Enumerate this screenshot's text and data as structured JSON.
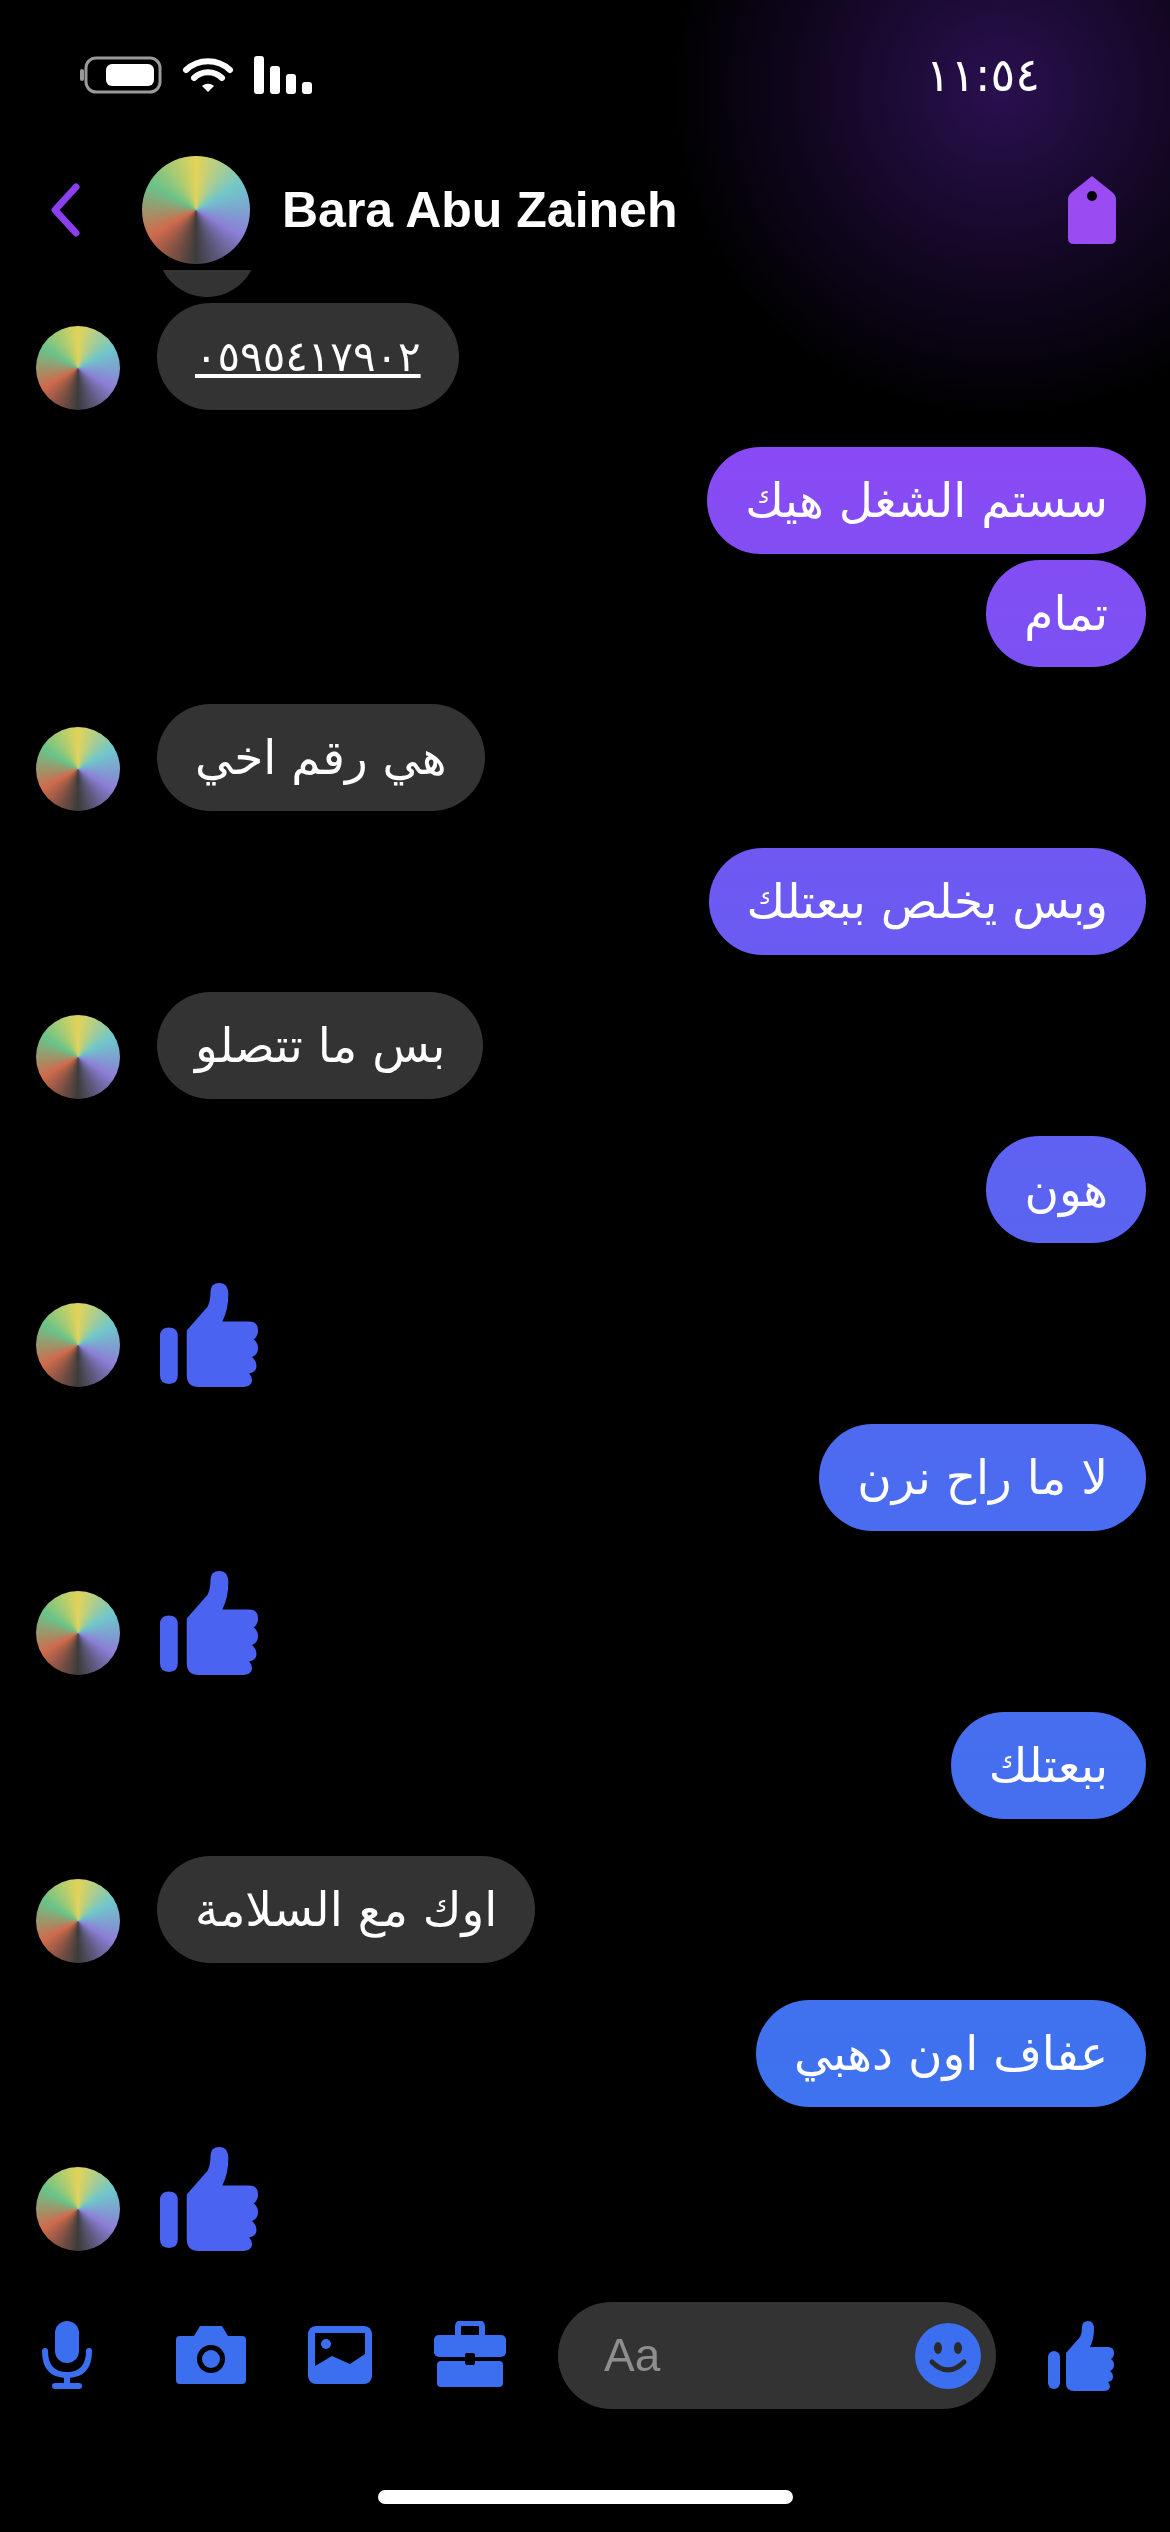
{
  "status_bar": {
    "time": "١١:٥٤"
  },
  "header": {
    "contact_name": "Bara Abu Zaineh"
  },
  "messages": [
    {
      "outgoing": false,
      "kind": "cut"
    },
    {
      "outgoing": false,
      "kind": "text",
      "text": "٠٥٩٥٤١٧٩٠٢",
      "link": true
    },
    {
      "outgoing": true,
      "kind": "text",
      "text": "سستم الشغل هيك"
    },
    {
      "outgoing": true,
      "kind": "text",
      "text": "تمام"
    },
    {
      "outgoing": false,
      "kind": "text",
      "text": "هي رقم اخي"
    },
    {
      "outgoing": true,
      "kind": "text",
      "text": "وبس يخلص ببعتلك"
    },
    {
      "outgoing": false,
      "kind": "text",
      "text": "بس ما تتصلو"
    },
    {
      "outgoing": true,
      "kind": "text",
      "text": "هون"
    },
    {
      "outgoing": false,
      "kind": "like"
    },
    {
      "outgoing": true,
      "kind": "text",
      "text": "لا ما راح نرن"
    },
    {
      "outgoing": false,
      "kind": "like"
    },
    {
      "outgoing": true,
      "kind": "text",
      "text": "ببعتلك"
    },
    {
      "outgoing": false,
      "kind": "text",
      "text": "اوك مع السلامة"
    },
    {
      "outgoing": true,
      "kind": "text",
      "text": "عفاف اون دهبي"
    },
    {
      "outgoing": false,
      "kind": "like"
    }
  ],
  "composer": {
    "placeholder": "Aa"
  }
}
